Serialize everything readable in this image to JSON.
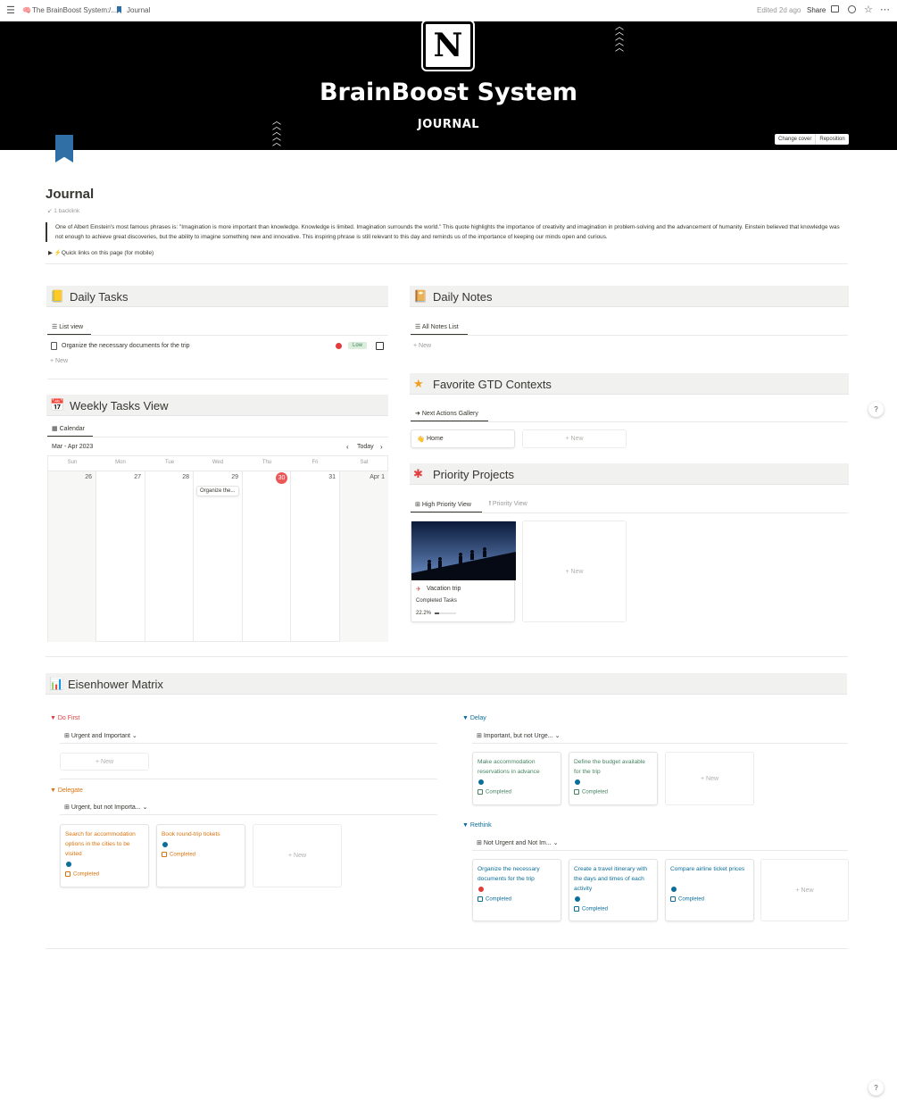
{
  "topbar": {
    "crumb1": "The BrainBoost System: ...",
    "sep": "/",
    "crumb2": "Journal",
    "edited": "Edited 2d ago",
    "share": "Share"
  },
  "cover": {
    "logo_letter": "N",
    "title": "BrainBoost System",
    "subtitle": "JOURNAL",
    "change_cover": "Change cover",
    "reposition": "Reposition"
  },
  "page": {
    "title": "Journal",
    "backlink": "1 backlink",
    "quote": "One of Albert Einstein's most famous phrases is: \"Imagination is more important than knowledge. Knowledge is limited. Imagination surrounds the world.\" This quote highlights the importance of creativity and imagination in problem-solving and the advancement of humanity. Einstein believed that knowledge was not enough to achieve great discoveries, but the ability to imagine something new and innovative. This inspiring phrase is still relevant to this day and reminds us of the importance of keeping our minds open and curious.",
    "toggle": "⚡Quick links on this page (for mobile)"
  },
  "daily_tasks": {
    "title": "Daily Tasks",
    "tab": "List view",
    "item": "Organize the necessary documents for the trip",
    "badge": "Low",
    "new": "New"
  },
  "daily_notes": {
    "title": "Daily Notes",
    "tab": "All Notes List",
    "new": "New"
  },
  "gtd": {
    "title": "Favorite GTD Contexts",
    "tab": "Next Actions Gallery",
    "card": "Home",
    "new": "New"
  },
  "weekly": {
    "title": "Weekly Tasks View",
    "tab": "Calendar",
    "month": "Mar - Apr 2023",
    "today": "Today",
    "days": [
      "Sun",
      "Mon",
      "Tue",
      "Wed",
      "Thu",
      "Fri",
      "Sat"
    ],
    "dates": [
      "26",
      "27",
      "28",
      "29",
      "30",
      "31",
      "Apr 1"
    ],
    "event": "Organize the..."
  },
  "priority": {
    "title": "Priority Projects",
    "tab1": "High Priority View",
    "tab2": "Priority View",
    "card_title": "Vacation trip",
    "card_sub": "Completed Tasks",
    "progress_label": "22.2%",
    "progress": 0.222,
    "new": "New"
  },
  "eisenhower": {
    "title": "Eisenhower Matrix",
    "do_first": {
      "label": "Do First",
      "view": "Urgent and Important",
      "new": "New"
    },
    "delegate": {
      "label": "Delegate",
      "view": "Urgent, but not Importa...",
      "cards": [
        {
          "title": "Search for accommodation options in the cities to be visited",
          "status": "Completed"
        },
        {
          "title": "Book round-trip tickets",
          "status": "Completed"
        }
      ],
      "new": "New"
    },
    "delay": {
      "label": "Delay",
      "view": "Important, but not Urge...",
      "cards": [
        {
          "title": "Make accommodation reservations in advance",
          "status": "Completed"
        },
        {
          "title": "Define the budget available for the trip",
          "status": "Completed"
        }
      ],
      "new": "New"
    },
    "rethink": {
      "label": "Rethink",
      "view": "Not Urgent and Not Im...",
      "cards": [
        {
          "title": "Organize the necessary documents for the trip",
          "status": "Completed"
        },
        {
          "title": "Create a travel itinerary with the days and times of each activity",
          "status": "Completed"
        },
        {
          "title": "Compare airline ticket prices",
          "status": "Completed"
        }
      ],
      "new": "New"
    }
  },
  "help": "?",
  "colors": {
    "red": "#e03e3e",
    "orange": "#d9730d",
    "blue": "#0b6e99",
    "green": "#448361",
    "cover": "#000000",
    "bookmark": "#2f6fa6"
  }
}
